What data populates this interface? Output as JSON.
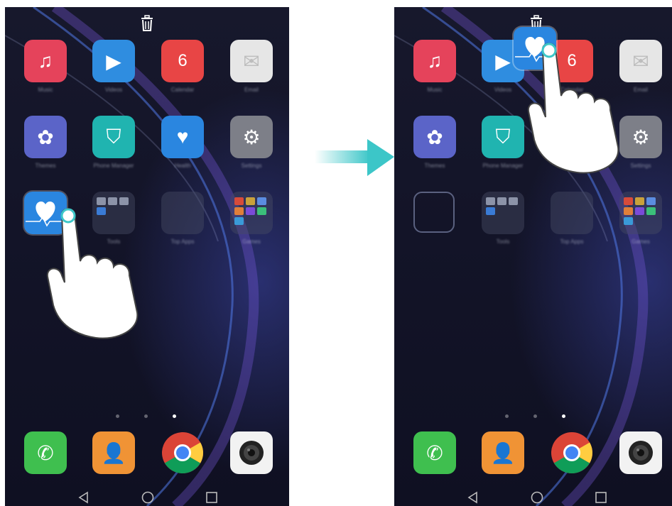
{
  "screens": [
    {
      "id": "before",
      "apps": [
        {
          "name": "Music",
          "color": "#e5435b",
          "glyph": "♫"
        },
        {
          "name": "Videos",
          "color": "#2f8de0",
          "glyph": "▶"
        },
        {
          "name": "Calendar",
          "color": "#e84545",
          "glyph": "6"
        },
        {
          "name": "Email",
          "color": "#e6e6e6",
          "glyph": "✉"
        },
        {
          "name": "Themes",
          "color": "#5b64c8",
          "glyph": "✿"
        },
        {
          "name": "Phone Manager",
          "color": "#20b4b0",
          "glyph": "⛉"
        },
        {
          "name": "Health",
          "color": "#2a86e0",
          "glyph": "♥"
        },
        {
          "name": "Settings",
          "color": "#7d7f88",
          "glyph": "⚙"
        }
      ],
      "dragged_app": {
        "name": "Health",
        "color": "#2a86e0"
      },
      "folders": [
        {
          "name": "Tools"
        },
        {
          "name": "Top Apps"
        },
        {
          "name": "Games"
        }
      ],
      "dock": [
        {
          "name": "Phone",
          "color": "#3fbf4f",
          "glyph": "✆"
        },
        {
          "name": "Contacts",
          "color": "#f09335",
          "glyph": "👤"
        },
        {
          "name": "Chrome",
          "color": "#ffffff",
          "glyph": ""
        },
        {
          "name": "Camera",
          "color": "#f2f2f2",
          "glyph": ""
        }
      ]
    },
    {
      "id": "after",
      "apps": [
        {
          "name": "Music",
          "color": "#e5435b",
          "glyph": "♫"
        },
        {
          "name": "Videos",
          "color": "#2f8de0",
          "glyph": "▶"
        },
        {
          "name": "Calendar",
          "color": "#e84545",
          "glyph": "6"
        },
        {
          "name": "Email",
          "color": "#e6e6e6",
          "glyph": "✉"
        },
        {
          "name": "Themes",
          "color": "#5b64c8",
          "glyph": "✿"
        },
        {
          "name": "Phone Manager",
          "color": "#20b4b0",
          "glyph": "⛉"
        },
        {
          "name": "Health",
          "color": "#2a86e0",
          "glyph": "♥"
        },
        {
          "name": "Settings",
          "color": "#7d7f88",
          "glyph": "⚙"
        }
      ],
      "folders": [
        {
          "name": "Tools"
        },
        {
          "name": "Top Apps"
        },
        {
          "name": "Games"
        }
      ],
      "dock": [
        {
          "name": "Phone",
          "color": "#3fbf4f",
          "glyph": "✆"
        },
        {
          "name": "Contacts",
          "color": "#f09335",
          "glyph": "👤"
        },
        {
          "name": "Chrome",
          "color": "#ffffff",
          "glyph": ""
        },
        {
          "name": "Camera",
          "color": "#f2f2f2",
          "glyph": ""
        }
      ]
    }
  ],
  "page_indicator": {
    "count": 3,
    "active": 3
  },
  "icons": {
    "trash": "trash-icon",
    "back": "back-nav-icon",
    "home": "home-nav-icon",
    "recents": "recents-nav-icon",
    "transition": "right-arrow-icon"
  },
  "accent": "#3cc6c8"
}
